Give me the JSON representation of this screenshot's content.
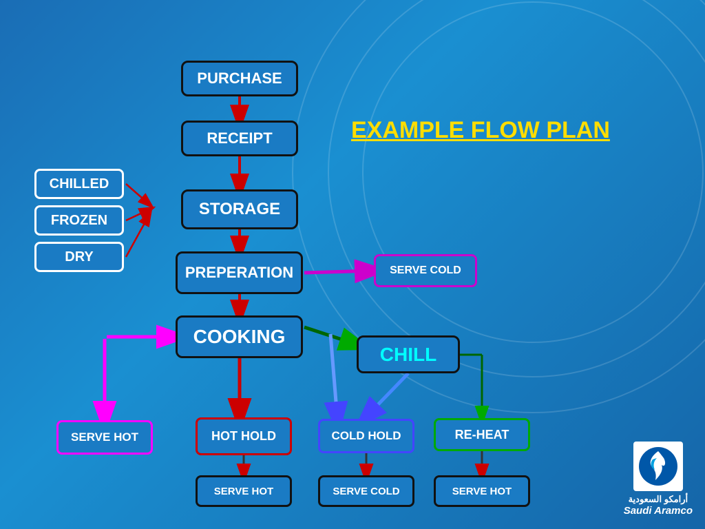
{
  "title": "EXAMPLE FLOW PLAN",
  "boxes": {
    "purchase": "PURCHASE",
    "receipt": "RECEIPT",
    "storage": "STORAGE",
    "preperation": "PREPERATION",
    "cooking": "COOKING",
    "chilled": "CHILLED",
    "frozen": "FROZEN",
    "dry": "DRY",
    "serve_cold_top": "SERVE COLD",
    "chill": "CHILL",
    "serve_hot_left": "SERVE HOT",
    "hot_hold": "HOT HOLD",
    "cold_hold": "COLD HOLD",
    "re_heat": "RE-HEAT",
    "serve_hot_bottom": "SERVE HOT",
    "serve_cold_bottom": "SERVE COLD",
    "serve_hot_right": "SERVE HOT"
  },
  "logo": {
    "company": "Saudi Aramco",
    "arabic": "أرامكو السعودية"
  }
}
